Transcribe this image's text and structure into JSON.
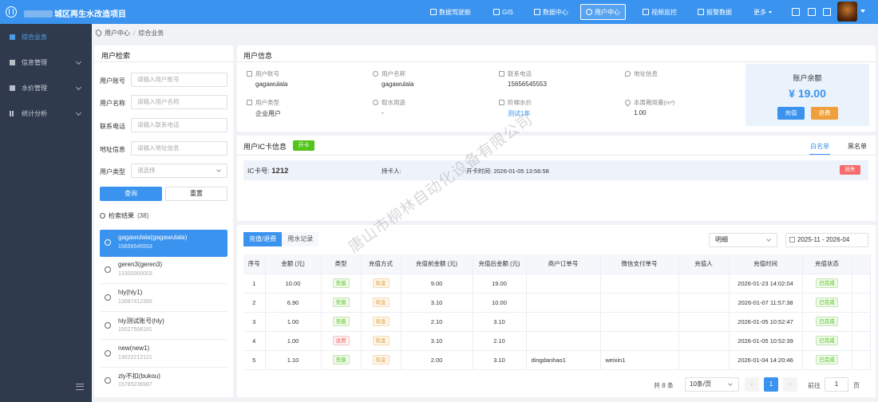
{
  "app": {
    "title": "城区再生水改造项目"
  },
  "topnav": {
    "items": [
      {
        "label": "数据驾驶舱",
        "icon": "dashboard-icon"
      },
      {
        "label": "GIS",
        "icon": "map-icon"
      },
      {
        "label": "数据中心",
        "icon": "database-icon"
      },
      {
        "label": "用户中心",
        "icon": "user-center-icon",
        "active": true
      },
      {
        "label": "视频监控",
        "icon": "video-icon"
      },
      {
        "label": "报警数据",
        "icon": "alarm-icon"
      },
      {
        "label": "更多"
      }
    ]
  },
  "sidebar": {
    "items": [
      {
        "label": "综合业务",
        "icon": "grid-icon",
        "active": true
      },
      {
        "label": "信息管理",
        "icon": "grid-icon"
      },
      {
        "label": "水价管理",
        "icon": "grid-icon"
      },
      {
        "label": "统计分析",
        "icon": "bar-chart-icon"
      }
    ]
  },
  "breadcrumb": {
    "root": "用户中心",
    "sep": "/",
    "current": "综合业务"
  },
  "search": {
    "title": "用户检索",
    "fields": [
      {
        "label": "用户账号",
        "placeholder": "请输入用户账号"
      },
      {
        "label": "用户名称",
        "placeholder": "请输入用户名称"
      },
      {
        "label": "联系电话",
        "placeholder": "请输入联系电话"
      },
      {
        "label": "地址信息",
        "placeholder": "请输入地址信息"
      },
      {
        "label": "用户类型",
        "placeholder": "请选择"
      }
    ],
    "query_label": "查询",
    "reset_label": "重置",
    "results_label": "检索结果",
    "results_count": "(38)",
    "results": [
      {
        "name": "gagawulala(gagawulala)",
        "phone": "15656545553"
      },
      {
        "name": "geren3(geren3)",
        "phone": "13300000003"
      },
      {
        "name": "hly(hly1)",
        "phone": "13087412365"
      },
      {
        "name": "hly测试账号(hly)",
        "phone": "15027508181"
      },
      {
        "name": "new(new1)",
        "phone": "13022212121"
      },
      {
        "name": "zly不扣(bukou)",
        "phone": "15785236987"
      }
    ]
  },
  "userinfo": {
    "title": "用户信息",
    "fields": [
      {
        "label": "用户账号",
        "value": "gagawulala"
      },
      {
        "label": "用户名称",
        "value": "gagawulala"
      },
      {
        "label": "联系电话",
        "value": "15656545553"
      },
      {
        "label": "地址信息",
        "value": ""
      },
      {
        "label": "用户类型",
        "value": "企业用户"
      },
      {
        "label": "取水用途",
        "value": "-"
      },
      {
        "label": "阶梯水价",
        "value": "测试1年"
      },
      {
        "label": "本周期用量(m³)",
        "value": "1.00"
      }
    ],
    "balance_label": "账户余额",
    "balance": "¥ 19.00",
    "recharge_label": "充值",
    "refund_label": "退费"
  },
  "iccard": {
    "title": "用户IC卡信息",
    "open_label": "开卡",
    "tabs": [
      "白名单",
      "黑名单"
    ],
    "card_label": "IC卡号:",
    "card_no": "1212",
    "holder_label": "持卡人:",
    "holder": "",
    "open_time_label": "开卡时间:",
    "open_time": "2026-01-05 13:56:58",
    "lost_label": "挂失"
  },
  "records": {
    "tabs": [
      "充值/退费",
      "用水记录"
    ],
    "filter": "明细",
    "date_from": "2025-11",
    "date_sep": "-",
    "date_to": "2026-04",
    "columns": [
      "序号",
      "金额 (元)",
      "类型",
      "充值方式",
      "充值前金额 (元)",
      "充值后金额 (元)",
      "商户订单号",
      "微信支付单号",
      "充值人",
      "充值时间",
      "充值状态"
    ],
    "rows": [
      {
        "no": "1",
        "amount": "10.00",
        "type": "充值",
        "method": "现金",
        "before": "9.00",
        "after": "19.00",
        "order": "",
        "wx": "",
        "by": "",
        "time": "2026-01-23 14:02:04",
        "status": "已完成"
      },
      {
        "no": "2",
        "amount": "6.90",
        "type": "充值",
        "method": "现金",
        "before": "3.10",
        "after": "10.00",
        "order": "",
        "wx": "",
        "by": "",
        "time": "2026-01-07 11:57:38",
        "status": "已完成"
      },
      {
        "no": "3",
        "amount": "1.00",
        "type": "充值",
        "method": "现金",
        "before": "2.10",
        "after": "3.10",
        "order": "",
        "wx": "",
        "by": "",
        "time": "2026-01-05 10:52:47",
        "status": "已完成"
      },
      {
        "no": "4",
        "amount": "1.00",
        "type": "退费",
        "method": "现金",
        "before": "3.10",
        "after": "2.10",
        "order": "",
        "wx": "",
        "by": "",
        "time": "2026-01-05 10:52:39",
        "status": "已完成"
      },
      {
        "no": "5",
        "amount": "1.10",
        "type": "充值",
        "method": "现金",
        "before": "2.00",
        "after": "3.10",
        "order": "dingdanhao1",
        "wx": "weixin1",
        "by": "",
        "time": "2026-01-04 14:20:46",
        "status": "已完成"
      }
    ],
    "total": "共 8 条",
    "page_size": "10条/页",
    "current_page": "1",
    "goto_label": "前往",
    "goto_value": "1",
    "page_unit": "页"
  },
  "watermark": "唐山市柳林自动化设备有限公司"
}
